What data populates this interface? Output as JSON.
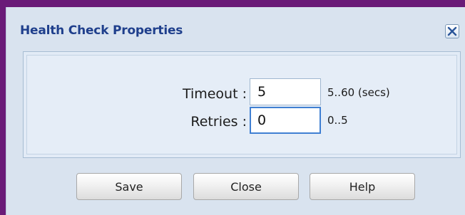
{
  "dialog": {
    "title": "Health Check Properties",
    "close_icon": "close-x-icon"
  },
  "fields": {
    "timeout": {
      "label": "Timeout :",
      "value": "5",
      "hint": "5..60 (secs)"
    },
    "retries": {
      "label": "Retries :",
      "value": "0",
      "hint": "0..5"
    }
  },
  "buttons": {
    "save": "Save",
    "close": "Close",
    "help": "Help"
  },
  "colors": {
    "frame": "#6a1b78",
    "dialog_bg": "#d9e3ef",
    "title": "#1f3f8c",
    "focus_border": "#3f7fd2"
  }
}
